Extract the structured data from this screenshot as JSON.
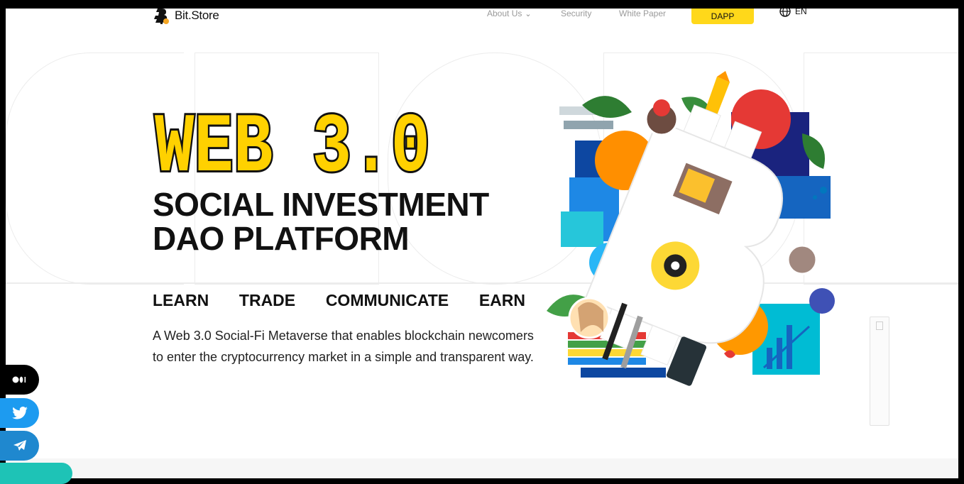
{
  "brand": {
    "name": "Bit.Store"
  },
  "nav": {
    "about": "About Us",
    "security": "Security",
    "whitepaper": "White Paper",
    "dapp": "DAPP",
    "lang": "EN"
  },
  "hero": {
    "pixel_title": "WEB 3.0",
    "headline_line1": "SOCIAL INVESTMENT",
    "headline_line2": "DAO PLATFORM",
    "verbs": [
      "LEARN",
      "TRADE",
      "COMMUNICATE",
      "EARN"
    ],
    "description": "A Web 3.0 Social-Fi Metaverse that enables blockchain newcomers to enter the cryptocurrency market in a simple and transparent way."
  },
  "colors": {
    "accent_yellow": "#ffd81a",
    "title_fill": "#ffd100",
    "twitter": "#1d9bf0",
    "telegram": "#1f88cf",
    "medium": "#000000",
    "extra": "#1ec3b6"
  },
  "icons": {
    "logo": "bitcoin-logo-icon",
    "chevron": "chevron-down-icon",
    "globe": "globe-icon",
    "medium": "medium-icon",
    "twitter": "twitter-icon",
    "telegram": "telegram-icon"
  }
}
